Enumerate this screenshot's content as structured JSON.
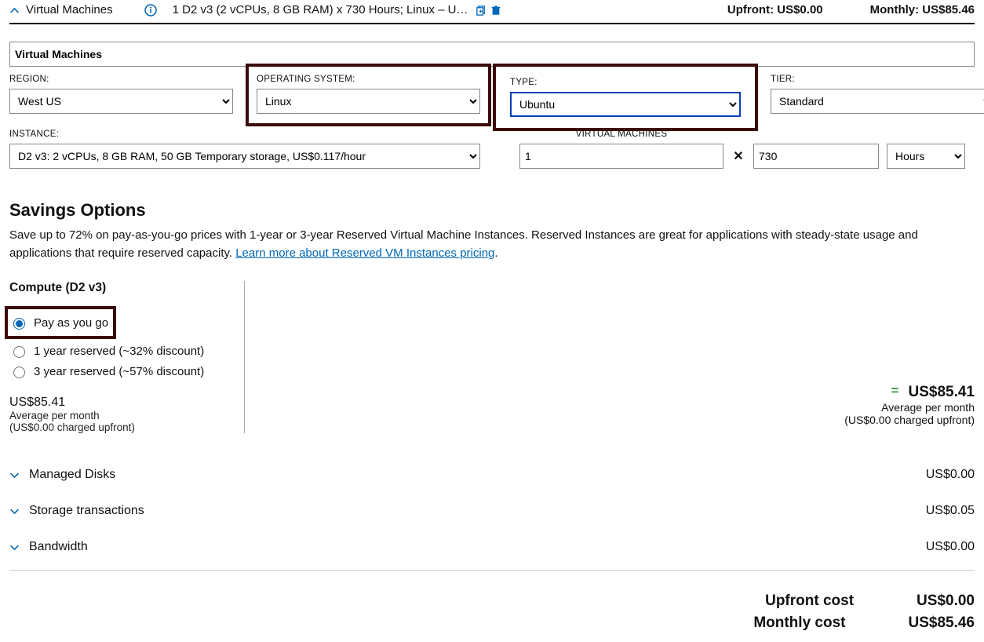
{
  "header": {
    "title": "Virtual Machines",
    "config_summary": "1 D2 v3 (2 vCPUs, 8 GB RAM) x 730 Hours; Linux – U…",
    "upfront_label": "Upfront:",
    "upfront_value": "US$0.00",
    "monthly_label": "Monthly:",
    "monthly_value": "US$85.46"
  },
  "name_field": "Virtual Machines",
  "fields": {
    "region": {
      "label": "REGION:",
      "value": "West US"
    },
    "os": {
      "label": "OPERATING SYSTEM:",
      "value": "Linux"
    },
    "type": {
      "label": "TYPE:",
      "value": "Ubuntu"
    },
    "tier": {
      "label": "TIER:",
      "value": "Standard"
    },
    "instance": {
      "label": "INSTANCE:",
      "value": "D2 v3: 2 vCPUs, 8 GB RAM, 50 GB Temporary storage, US$0.117/hour"
    },
    "vm_count": {
      "label": "VIRTUAL MACHINES",
      "value": "1"
    },
    "hours": {
      "value": "730",
      "unit": "Hours"
    }
  },
  "savings": {
    "heading": "Savings Options",
    "description": "Save up to 72% on pay-as-you-go prices with 1-year or 3-year Reserved Virtual Machine Instances. Reserved Instances are great for applications with steady-state usage and applications that require reserved capacity. ",
    "link_text": "Learn more about Reserved VM Instances pricing",
    "compute_heading": "Compute (D2 v3)",
    "options": [
      "Pay as you go",
      "1 year reserved (~32% discount)",
      "3 year reserved (~57% discount)"
    ],
    "selected": 0,
    "price_left": {
      "amount": "US$85.41",
      "avg": "Average per month",
      "upfront": "(US$0.00 charged upfront)"
    },
    "price_right": {
      "amount": "US$85.41",
      "avg": "Average per month",
      "upfront": "(US$0.00 charged upfront)"
    }
  },
  "accordions": [
    {
      "label": "Managed Disks",
      "value": "US$0.00"
    },
    {
      "label": "Storage transactions",
      "value": "US$0.05"
    },
    {
      "label": "Bandwidth",
      "value": "US$0.00"
    }
  ],
  "totals": {
    "upfront_label": "Upfront cost",
    "upfront_value": "US$0.00",
    "monthly_label": "Monthly cost",
    "monthly_value": "US$85.46"
  }
}
